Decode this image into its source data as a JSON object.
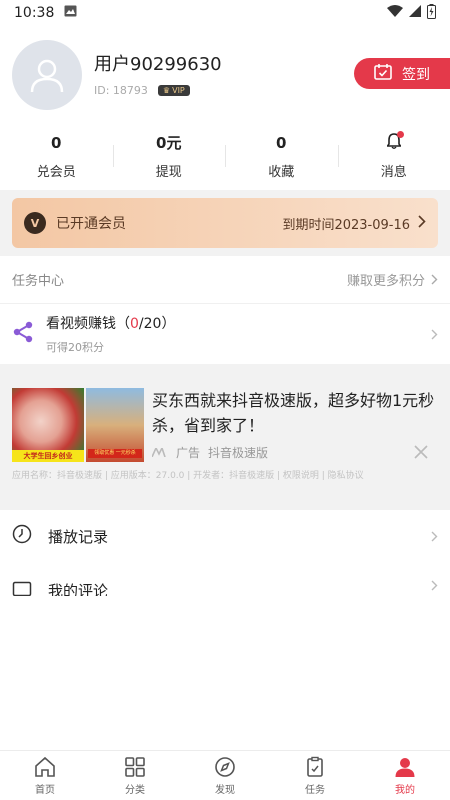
{
  "status_bar": {
    "time": "10:38"
  },
  "profile": {
    "username": "用户90299630",
    "user_id": "ID: 18793",
    "vip_badge": "VIP",
    "checkin_label": "签到"
  },
  "stats": [
    {
      "value": "0",
      "label": "兑会员"
    },
    {
      "value": "0元",
      "label": "提现"
    },
    {
      "value": "0",
      "label": "收藏"
    },
    {
      "value": "",
      "label": "消息"
    }
  ],
  "member": {
    "status": "已开通会员",
    "expiry": "到期时间2023-09-16"
  },
  "task_center": {
    "title": "任务中心",
    "more": "赚取更多积分",
    "task": {
      "name_prefix": "看视频赚钱（",
      "progress": "0",
      "name_suffix": "/20）",
      "reward": "可得20积分"
    }
  },
  "ad": {
    "title": "买东西就来抖音极速版，超多好物1元秒杀，省到家了！",
    "ad_tag": "广告",
    "advertiser": "抖音极速版",
    "image_caption_1": "大学生回乡创业",
    "image_caption_2": "领取优惠 一元秒杀",
    "app_info": "应用名称：抖音极速版 | 应用版本：27.0.0 | 开发者：抖音极速版 | 权限说明 | 隐私协议"
  },
  "menu": [
    {
      "label": "播放记录"
    },
    {
      "label": "我的评论"
    }
  ],
  "tabs": [
    {
      "label": "首页",
      "icon": "home-icon"
    },
    {
      "label": "分类",
      "icon": "grid-icon"
    },
    {
      "label": "发现",
      "icon": "compass-icon"
    },
    {
      "label": "任务",
      "icon": "clipboard-icon"
    },
    {
      "label": "我的",
      "icon": "user-icon"
    }
  ],
  "colors": {
    "accent": "#e4394a",
    "member_gradient_start": "#f3c7a4",
    "member_gradient_end": "#f9e0cc"
  }
}
